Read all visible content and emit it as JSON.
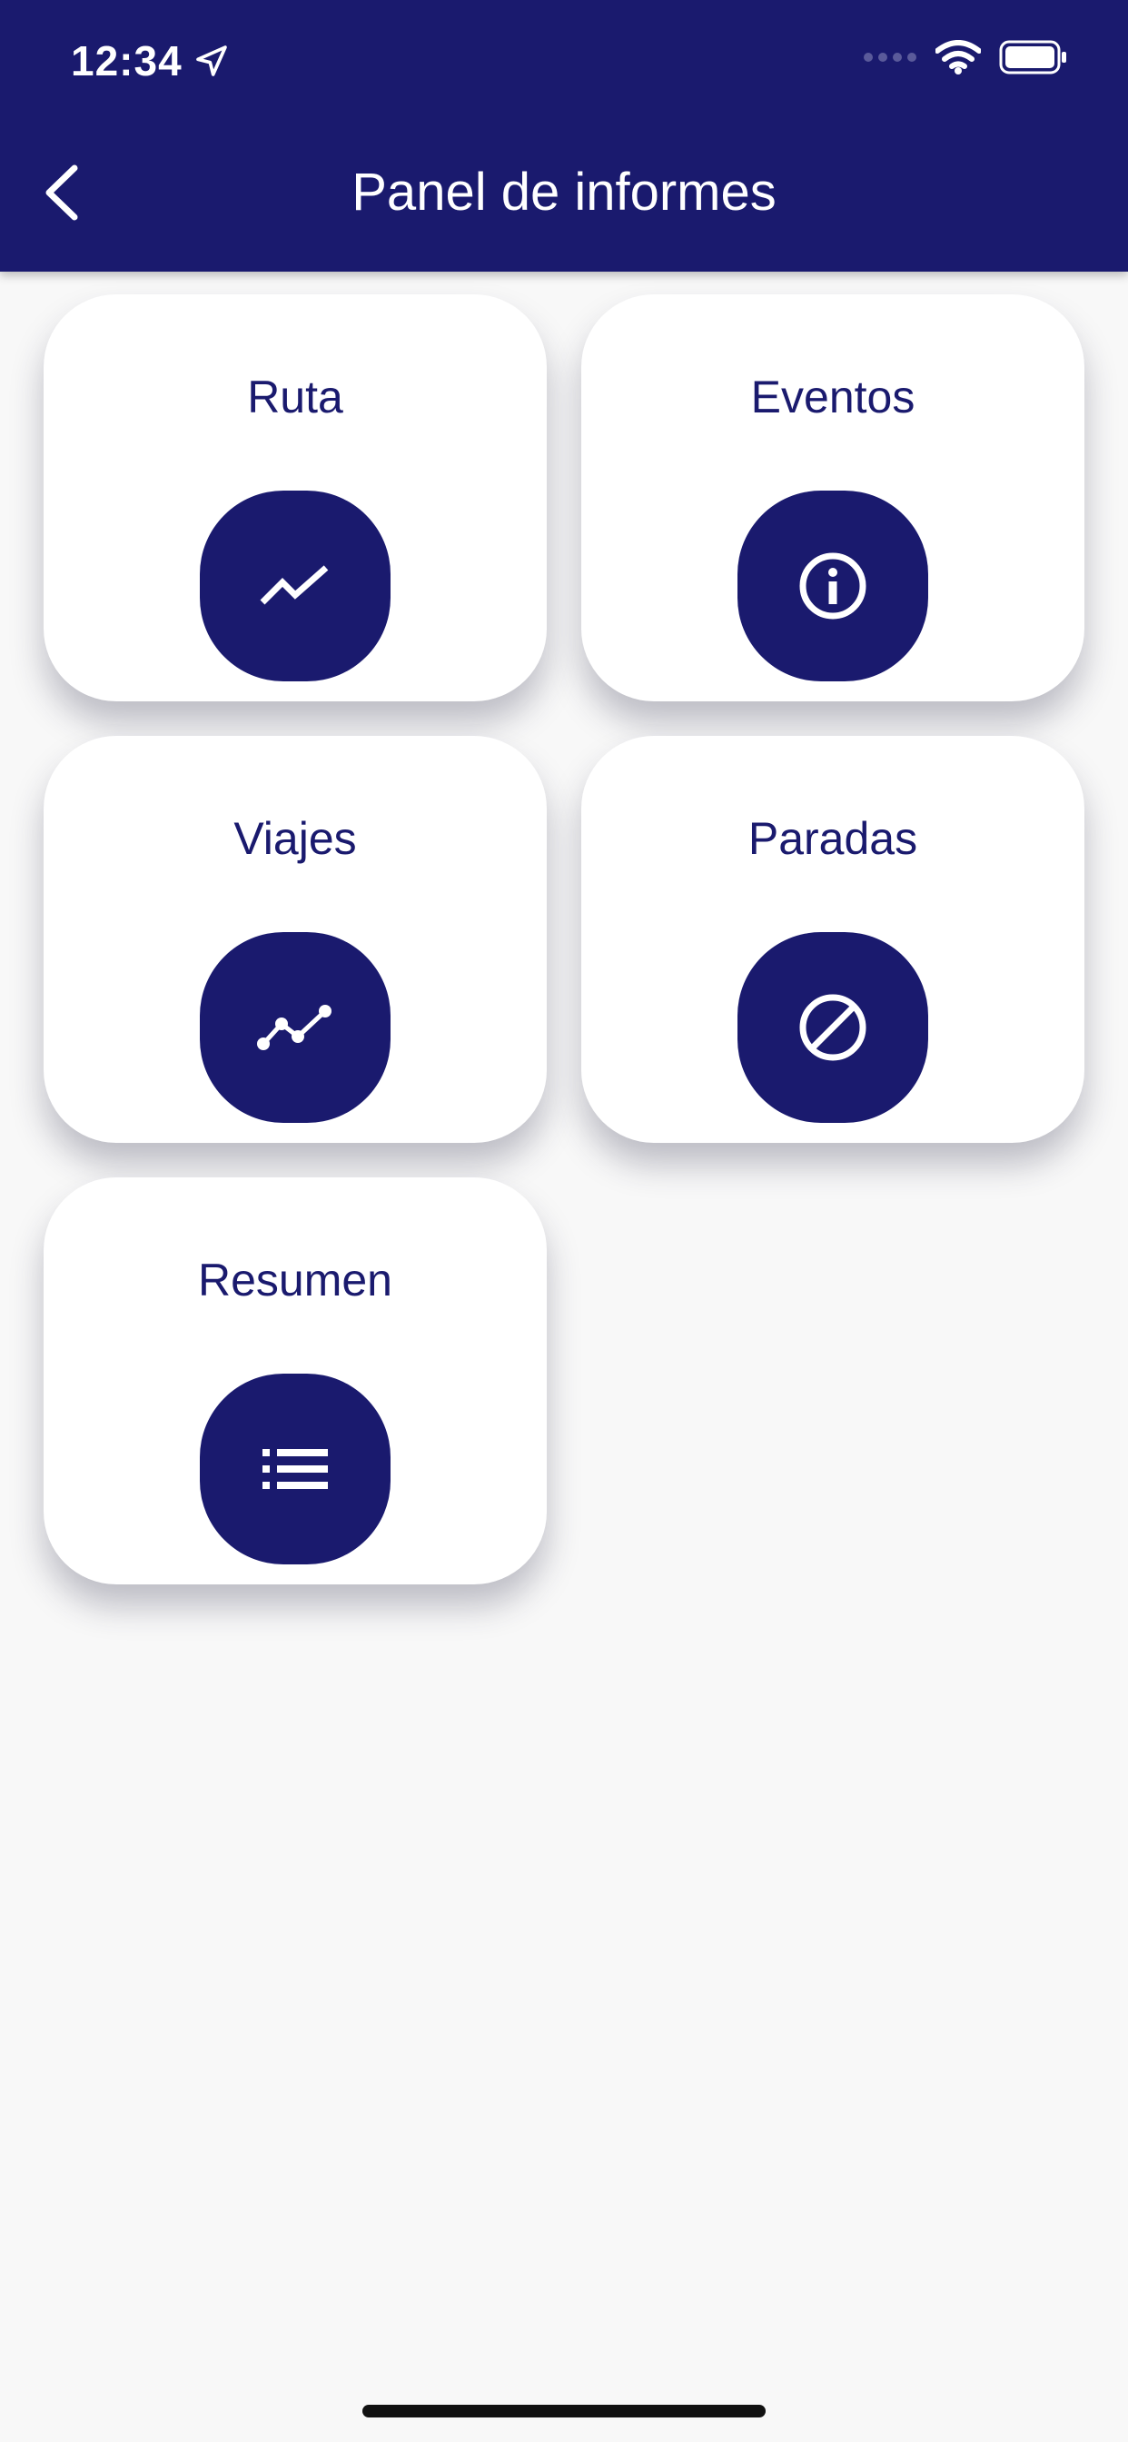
{
  "status_bar": {
    "time": "12:34",
    "icons": [
      "location-arrow-icon",
      "signal-dots-icon",
      "wifi-icon",
      "battery-icon"
    ]
  },
  "header": {
    "title": "Panel de informes",
    "back_icon": "chevron-left-icon",
    "background_color": "#1a1a6e"
  },
  "cards": [
    {
      "label": "Ruta",
      "icon": "trending-up-icon"
    },
    {
      "label": "Eventos",
      "icon": "info-icon"
    },
    {
      "label": "Viajes",
      "icon": "timeline-icon"
    },
    {
      "label": "Paradas",
      "icon": "block-icon"
    },
    {
      "label": "Resumen",
      "icon": "list-icon"
    }
  ],
  "colors": {
    "accent": "#1a1a6e",
    "card_background": "#ffffff",
    "page_background": "#f8f8f8"
  }
}
